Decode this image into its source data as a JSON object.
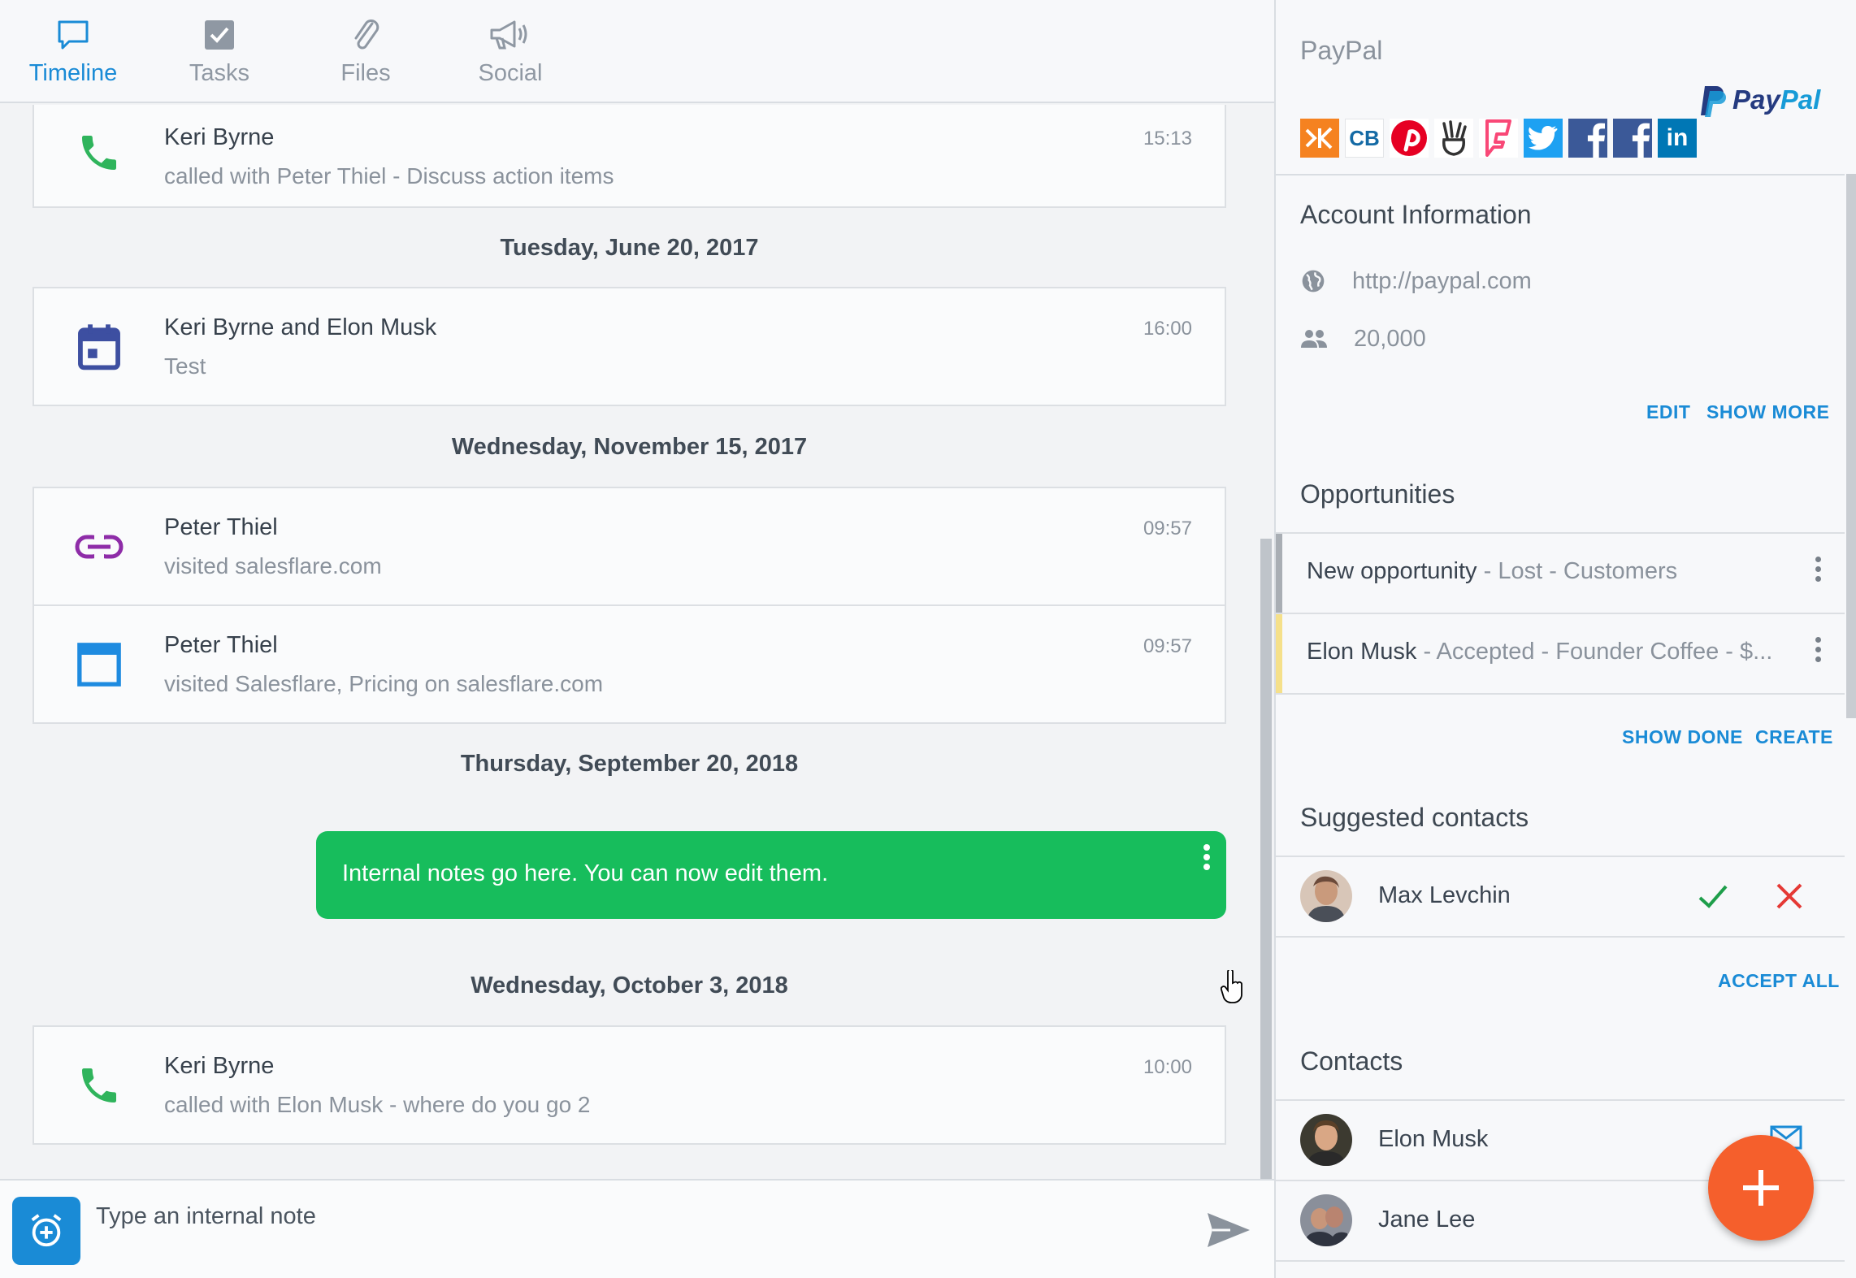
{
  "tabs": [
    {
      "label": "Timeline",
      "icon": "chat-bubble-icon",
      "active": true
    },
    {
      "label": "Tasks",
      "icon": "checkbox-icon",
      "active": false
    },
    {
      "label": "Files",
      "icon": "paperclip-icon",
      "active": false
    },
    {
      "label": "Social",
      "icon": "megaphone-icon",
      "active": false
    }
  ],
  "timeline": {
    "entries": [
      {
        "icon": "phone-icon",
        "title": "Keri Byrne",
        "subtitle": "called with Peter Thiel - Discuss action items",
        "time": "15:13"
      },
      {
        "icon": "calendar-icon",
        "title": "Keri Byrne and Elon Musk",
        "subtitle": "Test",
        "time": "16:00"
      },
      {
        "icon": "link-icon",
        "title": "Peter Thiel",
        "subtitle": "visited salesflare.com",
        "time": "09:57"
      },
      {
        "icon": "browser-window-icon",
        "title": "Peter Thiel",
        "subtitle": "visited Salesflare, Pricing on salesflare.com",
        "time": "09:57"
      },
      {
        "icon": "phone-icon",
        "title": "Keri Byrne",
        "subtitle": "called with Elon Musk - where do you go 2",
        "time": "10:00"
      }
    ],
    "dates": [
      "Tuesday, June 20, 2017",
      "Wednesday, November 15, 2017",
      "Thursday, September 20, 2018",
      "Wednesday, October 3, 2018"
    ],
    "internal_note": "Internal notes go here. You can now edit them."
  },
  "composer": {
    "placeholder": "Type an internal note"
  },
  "account": {
    "company": "PayPal",
    "logo_text_1": "Pay",
    "logo_text_2": "Pal",
    "social_icons": [
      {
        "name": "klout-icon",
        "text": "K",
        "bg": "#f58220"
      },
      {
        "name": "crunchbase-icon",
        "text": "CB",
        "bg": "#ffffff"
      },
      {
        "name": "pinterest-icon",
        "text": "P",
        "bg": "#e60023"
      },
      {
        "name": "angellist-icon",
        "text": "✌",
        "bg": "#ffffff"
      },
      {
        "name": "foursquare-icon",
        "text": "F",
        "bg": "#ffffff"
      },
      {
        "name": "twitter-icon",
        "text": "t",
        "bg": "#1da1f2"
      },
      {
        "name": "facebook-icon",
        "text": "f",
        "bg": "#3b5998"
      },
      {
        "name": "facebook-icon-2",
        "text": "f",
        "bg": "#3b5998"
      },
      {
        "name": "linkedin-icon",
        "text": "in",
        "bg": "#0077b5"
      }
    ],
    "info_title": "Account Information",
    "website": "http://paypal.com",
    "employees": "20,000",
    "edit_label": "EDIT",
    "show_more_label": "SHOW MORE",
    "opportunities_title": "Opportunities",
    "opportunities": [
      {
        "name": "New opportunity",
        "status": " - Lost",
        "stage": " - Customers",
        "extra": "",
        "bar_color": "#a9aeb4"
      },
      {
        "name": "Elon Musk",
        "status": " - Accepted",
        "stage": " - Founder Coffee",
        "extra": " - $...",
        "bar_color": "#f5e08a"
      }
    ],
    "show_done_label": "SHOW DONE",
    "create_label": "CREATE",
    "suggested_title": "Suggested contacts",
    "suggested": [
      {
        "name": "Max Levchin"
      }
    ],
    "accept_all_label": "ACCEPT ALL",
    "contacts_title": "Contacts",
    "contacts": [
      {
        "name": "Elon Musk"
      },
      {
        "name": "Jane Lee"
      }
    ]
  },
  "colors": {
    "accent": "#1a8bd6",
    "note_green": "#17bd5c",
    "fab": "#f55f2c",
    "accept_green": "#1e9e4a",
    "reject_red": "#e53935"
  }
}
